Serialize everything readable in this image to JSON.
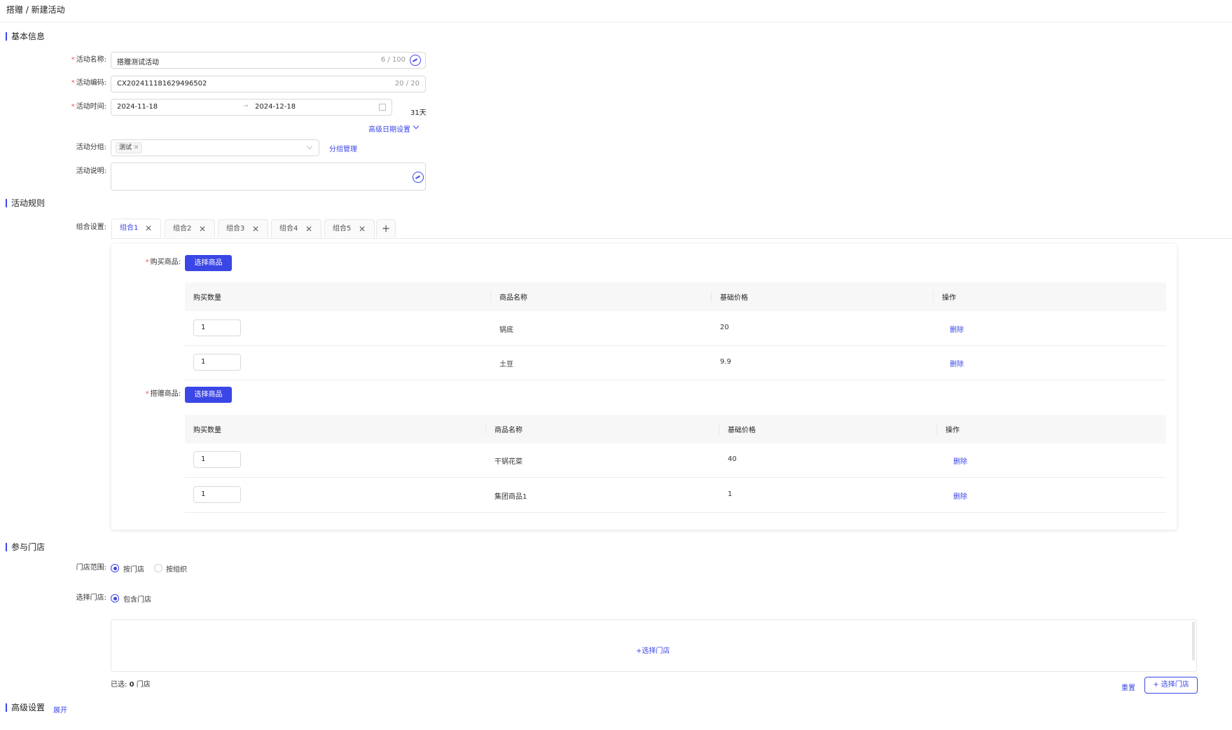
{
  "breadcrumb": "搭赠 / 新建活动",
  "sections": {
    "basic": "基本信息",
    "rules": "活动规则",
    "stores": "参与门店",
    "advanced": "高级设置",
    "advanced_toggle": "展开"
  },
  "basic": {
    "name_label": "活动名称:",
    "name_value": "搭赠测试活动",
    "name_count": "6 / 100",
    "code_label": "活动编码:",
    "code_value": "CX202411181629496502",
    "code_count": "20 / 20",
    "time_label": "活动时间:",
    "start_date": "2024-11-18",
    "end_date": "2024-12-18",
    "date_arrow": "→",
    "days": "31天",
    "advanced_date": "高级日期设置",
    "group_label": "活动分组:",
    "group_tag": "测试",
    "group_manage": "分组管理",
    "desc_label": "活动说明:",
    "required_mark": "*"
  },
  "rules": {
    "combo_label": "组合设置:",
    "tabs": [
      {
        "label": "组合1",
        "active": true
      },
      {
        "label": "组合2",
        "active": false
      },
      {
        "label": "组合3",
        "active": false
      },
      {
        "label": "组合4",
        "active": false
      },
      {
        "label": "组合5",
        "active": false
      }
    ],
    "tab_close": "✕",
    "tab_add": "+",
    "buy": {
      "label": "购买商品:",
      "button": "选择商品",
      "columns": [
        "购买数量",
        "商品名称",
        "基础价格",
        "操作"
      ],
      "rows": [
        {
          "qty": "1",
          "name": "锅底",
          "price": "20",
          "action": "删除"
        },
        {
          "qty": "1",
          "name": "土豆",
          "price": "9.9",
          "action": "删除"
        }
      ]
    },
    "gift": {
      "label": "搭赠商品:",
      "button": "选择商品",
      "columns": [
        "购买数量",
        "商品名称",
        "基础价格",
        "操作"
      ],
      "rows": [
        {
          "qty": "1",
          "name": "干锅花菜",
          "price": "40",
          "action": "删除"
        },
        {
          "qty": "1",
          "name": "集团商品1",
          "price": "1",
          "action": "删除"
        }
      ]
    }
  },
  "stores": {
    "scope_label": "门店范围:",
    "scope_options": [
      {
        "label": "按门店",
        "selected": true
      },
      {
        "label": "按组织",
        "selected": false
      }
    ],
    "select_label": "选择门店:",
    "select_option": "包含门店",
    "box_link": "+选择门店",
    "selected_prefix": "已选:",
    "selected_count": "0",
    "selected_suffix": "门店",
    "reset": "重置",
    "add_button": "+ 选择门店"
  },
  "colors": {
    "accent": "#3b46e6",
    "required": "#ff4d4f"
  }
}
